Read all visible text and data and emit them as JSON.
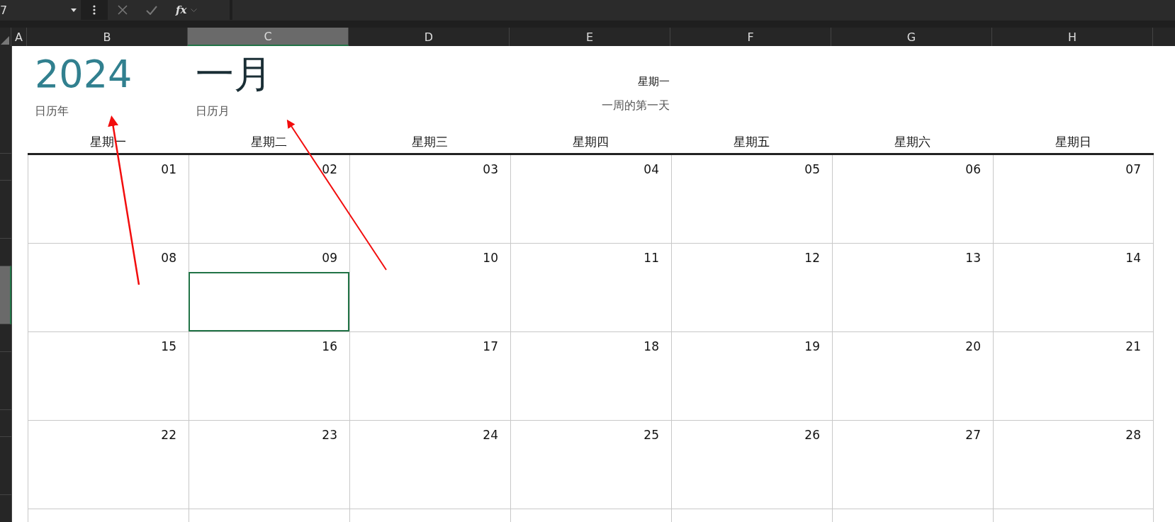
{
  "formula_bar": {
    "name_box": "7",
    "function_label": "fx"
  },
  "column_headers": [
    {
      "label": "A",
      "selected": false
    },
    {
      "label": "B",
      "selected": false
    },
    {
      "label": "C",
      "selected": true
    },
    {
      "label": "D",
      "selected": false
    },
    {
      "label": "E",
      "selected": false
    },
    {
      "label": "F",
      "selected": false
    },
    {
      "label": "G",
      "selected": false
    },
    {
      "label": "H",
      "selected": false
    }
  ],
  "calendar": {
    "year": "2024",
    "year_label": "日历年",
    "month": "一月",
    "month_label": "日历月",
    "first_day": "星期一",
    "first_day_label": "一周的第一天",
    "weekdays": [
      "星期一",
      "星期二",
      "星期三",
      "星期四",
      "星期五",
      "星期六",
      "星期日"
    ],
    "weeks": [
      [
        {
          "day": "01",
          "selected": false
        },
        {
          "day": "02",
          "selected": false
        },
        {
          "day": "03",
          "selected": false
        },
        {
          "day": "04",
          "selected": false
        },
        {
          "day": "05",
          "selected": false
        },
        {
          "day": "06",
          "selected": false
        },
        {
          "day": "07",
          "selected": false
        }
      ],
      [
        {
          "day": "08",
          "selected": false
        },
        {
          "day": "09",
          "selected": true
        },
        {
          "day": "10",
          "selected": false
        },
        {
          "day": "11",
          "selected": false
        },
        {
          "day": "12",
          "selected": false
        },
        {
          "day": "13",
          "selected": false
        },
        {
          "day": "14",
          "selected": false
        }
      ],
      [
        {
          "day": "15",
          "selected": false
        },
        {
          "day": "16",
          "selected": false
        },
        {
          "day": "17",
          "selected": false
        },
        {
          "day": "18",
          "selected": false
        },
        {
          "day": "19",
          "selected": false
        },
        {
          "day": "20",
          "selected": false
        },
        {
          "day": "21",
          "selected": false
        }
      ],
      [
        {
          "day": "22",
          "selected": false
        },
        {
          "day": "23",
          "selected": false
        },
        {
          "day": "24",
          "selected": false
        },
        {
          "day": "25",
          "selected": false
        },
        {
          "day": "26",
          "selected": false
        },
        {
          "day": "27",
          "selected": false
        },
        {
          "day": "28",
          "selected": false
        }
      ]
    ]
  }
}
